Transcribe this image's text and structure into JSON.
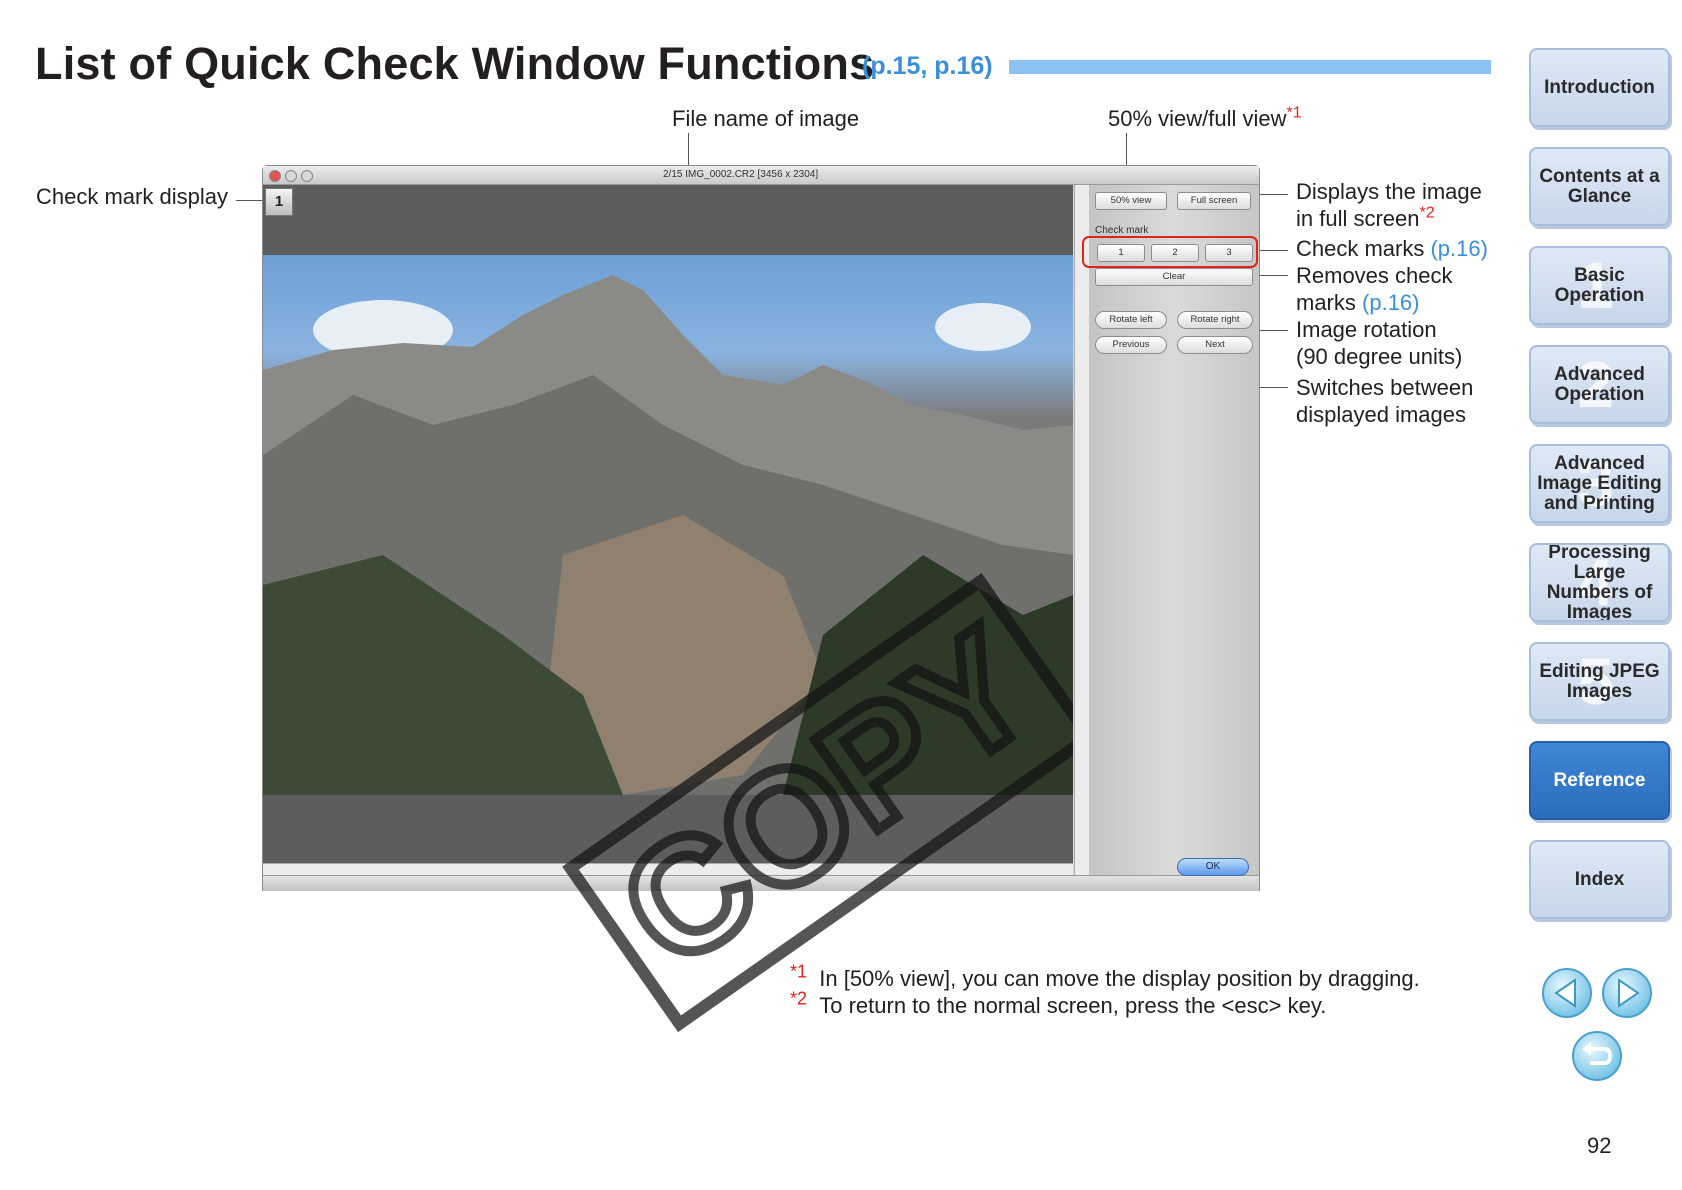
{
  "header": {
    "title": "List of Quick Check Window Functions",
    "title_refs": "(p.15, p.16)"
  },
  "callouts": {
    "file_name": "File name of image",
    "view_toggle": "50% view/full view",
    "view_toggle_note": "*1",
    "check_mark_display": "Check mark display",
    "full_screen_line1": "Displays the image",
    "full_screen_line2": "in full screen",
    "full_screen_note": "*2",
    "check_marks": "Check marks",
    "check_marks_ref": "(p.16)",
    "clear_line1": "Removes check",
    "clear_line2": "marks",
    "clear_ref": "(p.16)",
    "rotation_line1": "Image rotation",
    "rotation_line2": "(90 degree units)",
    "switch_line1": "Switches between",
    "switch_line2": "displayed images"
  },
  "window": {
    "title": "2/15 IMG_0002.CR2 [3456 x 2304]",
    "check_badge": "1",
    "buttons": {
      "view_50": "50% view",
      "full_screen": "Full screen",
      "check_mark_label": "Check mark",
      "check_1": "1",
      "check_2": "2",
      "check_3": "3",
      "clear": "Clear",
      "rotate_left": "Rotate left",
      "rotate_right": "Rotate right",
      "previous": "Previous",
      "next": "Next",
      "ok": "OK"
    },
    "watermark": "COPY"
  },
  "footnotes": [
    {
      "marker": "*1",
      "text": "In [50% view], you can move the display position by dragging."
    },
    {
      "marker": "*2",
      "text": "To return to the normal screen, press the <esc> key."
    }
  ],
  "sidebar": {
    "items": [
      {
        "label": "Introduction",
        "number": ""
      },
      {
        "label": "Contents at a Glance",
        "number": ""
      },
      {
        "label": "Basic Operation",
        "number": "1"
      },
      {
        "label": "Advanced Operation",
        "number": "2"
      },
      {
        "label": "Advanced Image Editing and Printing",
        "number": "3"
      },
      {
        "label": "Processing Large Numbers of Images",
        "number": "4"
      },
      {
        "label": "Editing JPEG Images",
        "number": "5"
      },
      {
        "label": "Reference",
        "number": ""
      },
      {
        "label": "Index",
        "number": ""
      }
    ],
    "active": "Reference"
  },
  "page_number": "92",
  "colors": {
    "accent_blue": "#3a8fd9",
    "note_red": "#e2231a",
    "nav_active": "#2f76c9"
  }
}
